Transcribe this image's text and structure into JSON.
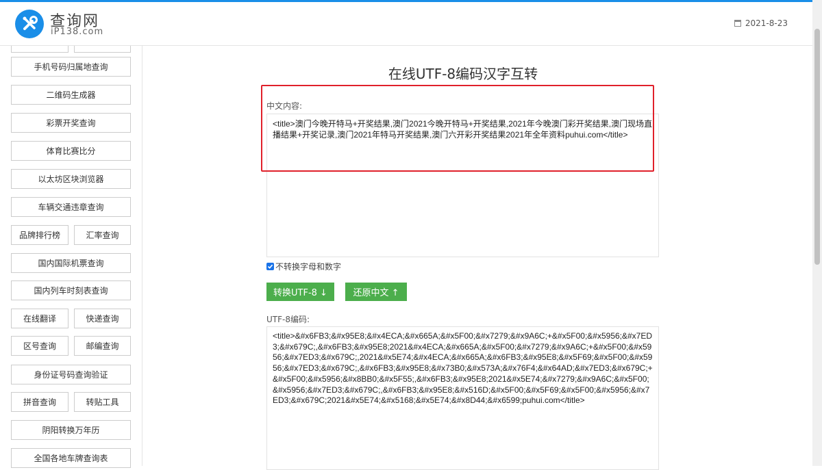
{
  "header": {
    "logo_name": "查询网",
    "logo_domain": "iP138.com",
    "date": "2021-8-23"
  },
  "sidebar": {
    "items": [
      {
        "label": "手机号码归属地查询"
      },
      {
        "label": "二维码生成器"
      },
      {
        "label": "彩票开奖查询"
      },
      {
        "label": "体育比赛比分"
      },
      {
        "label": "以太坊区块浏览器"
      },
      {
        "label": "车辆交通违章查询"
      },
      {
        "label": "品牌排行榜"
      },
      {
        "label": "汇率查询"
      },
      {
        "label": "国内国际机票查询"
      },
      {
        "label": "国内列车时刻表查询"
      },
      {
        "label": "在线翻译"
      },
      {
        "label": "快递查询"
      },
      {
        "label": "区号查询"
      },
      {
        "label": "邮编查询"
      },
      {
        "label": "身份证号码查询验证"
      },
      {
        "label": "拼音查询"
      },
      {
        "label": "转贴工具"
      },
      {
        "label": "阴阳转换万年历"
      },
      {
        "label": "全国各地车牌查询表"
      }
    ]
  },
  "main": {
    "title": "在线UTF-8编码汉字互转",
    "chinese_label": "中文内容:",
    "chinese_text": "<title>澳门今晚开特马+开奖结果,澳门2021今晚开特马+开奖结果,2021年今晚澳门彩开奖结果,澳门现场直播结果+开奖记录,澳门2021年特马开奖结果,澳门六开彩开奖结果2021年全年资料puhui.com</title>",
    "checkbox_label": "不转换字母和数字",
    "convert_button": "转换UTF-8 ↓",
    "restore_button": "还原中文 ↑",
    "utf8_label": "UTF-8编码:",
    "utf8_text": "<title>&#x6FB3;&#x95E8;&#x4ECA;&#x665A;&#x5F00;&#x7279;&#x9A6C;+&#x5F00;&#x5956;&#x7ED3;&#x679C;,&#x6FB3;&#x95E8;2021&#x4ECA;&#x665A;&#x5F00;&#x7279;&#x9A6C;+&#x5F00;&#x5956;&#x7ED3;&#x679C;,2021&#x5E74;&#x4ECA;&#x665A;&#x6FB3;&#x95E8;&#x5F69;&#x5F00;&#x5956;&#x7ED3;&#x679C;,&#x6FB3;&#x95E8;&#x73B0;&#x573A;&#x76F4;&#x64AD;&#x7ED3;&#x679C;+&#x5F00;&#x5956;&#x8BB0;&#x5F55;,&#x6FB3;&#x95E8;2021&#x5E74;&#x7279;&#x9A6C;&#x5F00;&#x5956;&#x7ED3;&#x679C;,&#x6FB3;&#x95E8;&#x516D;&#x5F00;&#x5F69;&#x5F00;&#x5956;&#x7ED3;&#x679C;2021&#x5E74;&#x5168;&#x5E74;&#x8D44;&#x6599;puhui.com</title>"
  },
  "colors": {
    "brand_blue": "#1a8ee8",
    "button_green": "#4cae4c",
    "highlight_red": "#e0202a"
  }
}
